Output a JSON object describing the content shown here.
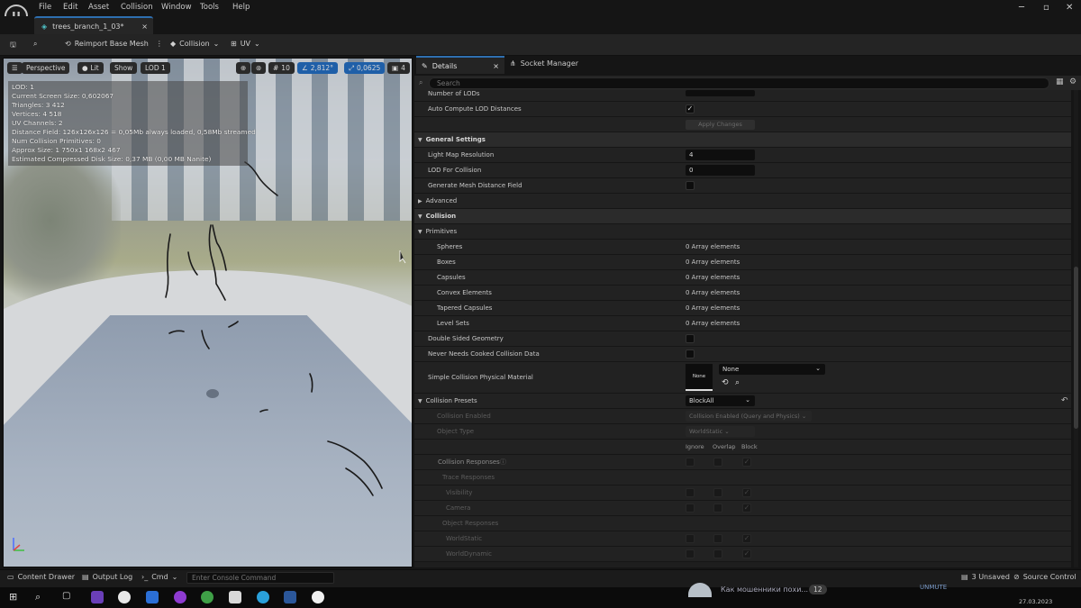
{
  "menu": {
    "items": [
      "File",
      "Edit",
      "Asset",
      "Collision",
      "Window",
      "Tools",
      "Help"
    ]
  },
  "tab": {
    "title": "trees_branch_1_03*",
    "close": "×"
  },
  "toolbar": {
    "reimport": "Reimport Base Mesh",
    "collision": "Collision",
    "uv": "UV"
  },
  "viewport": {
    "perspective": "Perspective",
    "lit": "Lit",
    "show": "Show",
    "lod": "LOD 1",
    "grid": "10",
    "angle": "2,812°",
    "scale": "0,0625",
    "cam": "4",
    "stats": [
      "LOD: 1",
      "Current Screen Size: 0,602067",
      "Triangles: 3 412",
      "Vertices: 4 518",
      "UV Channels: 2",
      "Distance Field: 126x126x126 = 0,05Mb always loaded, 0,58Mb streamed",
      "Num Collision Primitives: 0",
      "Approx Size: 1 750x1 168x2 467",
      "Estimated Compressed Disk Size: 0,37 MB (0,00 MB Nanite)"
    ]
  },
  "details": {
    "tab_details": "Details",
    "tab_socket": "Socket Manager",
    "search_placeholder": "Search",
    "rows": {
      "num_lods": "Number of LODs",
      "auto_lod": "Auto Compute LOD Distances",
      "apply": "Apply Changes",
      "general": "General Settings",
      "lightmap": "Light Map Resolution",
      "lightmap_val": "4",
      "lod_collision": "LOD For Collision",
      "lod_collision_val": "0",
      "gen_df": "Generate Mesh Distance Field",
      "advanced": "Advanced",
      "collision": "Collision",
      "primitives": "Primitives",
      "spheres": "Spheres",
      "boxes": "Boxes",
      "capsules": "Capsules",
      "convex": "Convex Elements",
      "tapered": "Tapered Capsules",
      "levelsets": "Level Sets",
      "array_val": "0 Array elements",
      "double_sided": "Double Sided Geometry",
      "never_cooked": "Never Needs Cooked Collision Data",
      "simple_mat": "Simple Collision Physical Material",
      "mat_thumb": "None",
      "mat_dropdown": "None",
      "presets": "Collision Presets",
      "presets_val": "BlockAll",
      "coll_enabled": "Collision Enabled",
      "coll_enabled_val": "Collision Enabled (Query and Physics)",
      "object_type": "Object Type",
      "object_type_val": "WorldStatic",
      "ignore": "Ignore",
      "overlap": "Overlap",
      "block": "Block",
      "responses": "Collision Responses",
      "trace": "Trace Responses",
      "visibility": "Visibility",
      "camera": "Camera",
      "object_resp": "Object Responses",
      "worldstatic": "WorldStatic",
      "worlddynamic": "WorldDynamic"
    }
  },
  "bottom": {
    "content_drawer": "Content Drawer",
    "output_log": "Output Log",
    "cmd": "Cmd",
    "console_placeholder": "Enter Console Command",
    "unsaved": "3 Unsaved",
    "source": "Source Control"
  },
  "taskbar": {
    "notification": "Как мошенники похи...",
    "badge": "12",
    "unmute": "UNMUTE",
    "date": "27.03.2023"
  }
}
